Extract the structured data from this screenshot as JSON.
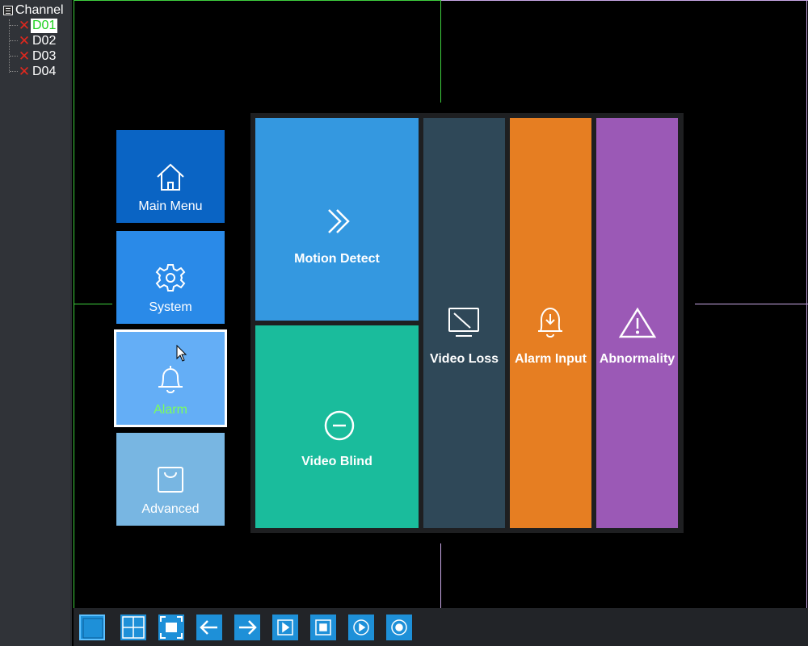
{
  "sidebar": {
    "root_label": "Channel",
    "channels": [
      {
        "label": "D01",
        "selected": true,
        "status": "disconnected"
      },
      {
        "label": "D02",
        "selected": false,
        "status": "disconnected"
      },
      {
        "label": "D03",
        "selected": false,
        "status": "disconnected"
      },
      {
        "label": "D04",
        "selected": false,
        "status": "disconnected"
      }
    ]
  },
  "menu": {
    "items": [
      {
        "label": "Main Menu",
        "icon": "home-icon",
        "color": "#0a64c4"
      },
      {
        "label": "System",
        "icon": "gear-icon",
        "color": "#2a8ae8"
      },
      {
        "label": "Alarm",
        "icon": "bell-icon",
        "color": "#64aef6",
        "active": true
      },
      {
        "label": "Advanced",
        "icon": "bag-icon",
        "color": "#78b6e2"
      }
    ]
  },
  "alarm_panel": {
    "tiles": [
      {
        "label": "Motion Detect",
        "icon": "double-chevron-right-icon",
        "color": "#3498e0"
      },
      {
        "label": "Video Blind",
        "icon": "minus-circle-icon",
        "color": "#1abc9c"
      },
      {
        "label": "Video Loss",
        "icon": "monitor-slash-icon",
        "color": "#2f4858"
      },
      {
        "label": "Alarm Input",
        "icon": "bell-download-icon",
        "color": "#e67e22"
      },
      {
        "label": "Abnormality",
        "icon": "warning-triangle-icon",
        "color": "#9b59b6"
      }
    ]
  },
  "toolbar": {
    "buttons": [
      {
        "icon": "single-view-icon"
      },
      {
        "icon": "quad-view-icon"
      },
      {
        "icon": "fullscreen-icon"
      },
      {
        "icon": "arrow-left-icon"
      },
      {
        "icon": "arrow-right-icon"
      },
      {
        "icon": "play-icon"
      },
      {
        "icon": "record-icon"
      },
      {
        "icon": "playback-icon"
      },
      {
        "icon": "target-icon"
      }
    ]
  }
}
